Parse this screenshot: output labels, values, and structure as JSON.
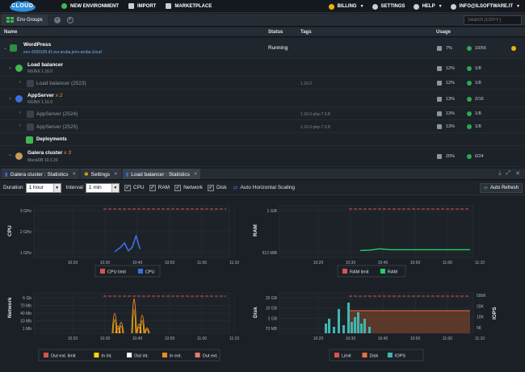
{
  "topbar": {
    "logo_text": "CLOUD",
    "new_environment": "NEW ENVIRONMENT",
    "import": "IMPORT",
    "marketplace": "MARKETPLACE",
    "billing": "BILLING",
    "settings": "SETTINGS",
    "help": "HELP",
    "user": "INFO@ILSOFTWARE.IT"
  },
  "groups": {
    "tab_label": "Env Groups",
    "search_placeholder": "Search (Ctrl+F)"
  },
  "columns": {
    "name": "Name",
    "status": "Status",
    "tags": "Tags",
    "usage": "Usage"
  },
  "environments": [
    {
      "name": "WordPress",
      "domain": "env-3289199.it1.eur.aruba.jenv-aruba.cloud",
      "status": "Running",
      "disk": "7%",
      "cloudlets": "10/56"
    },
    {
      "name": "Load balancer",
      "version": "NGINX 1.16.0",
      "disk": "12%",
      "cloudlets": "1/8"
    },
    {
      "name": "Load balancer (2523)",
      "tag": "1.16.0",
      "disk": "12%",
      "cloudlets": "1/8"
    },
    {
      "name": "AppServer",
      "mult": "x 2",
      "version": "NGINX 1.16.0",
      "disk": "13%",
      "cloudlets": "2/16"
    },
    {
      "name": "AppServer (2524)",
      "tag": "1.16.0-php-7.3.8",
      "disk": "13%",
      "cloudlets": "1/8"
    },
    {
      "name": "AppServer (2525)",
      "tag": "1.16.0-php-7.3.8",
      "disk": "13%",
      "cloudlets": "1/8"
    },
    {
      "name": "Deployments"
    },
    {
      "name": "Galera cluster",
      "mult": "x 3",
      "version": "MariaDB 10.3.20",
      "disk": "20%",
      "cloudlets": "6/24"
    }
  ],
  "panel": {
    "tabs": [
      "Galera cluster : Statistics",
      "Settings",
      "Load balancer : Statistics"
    ],
    "duration_label": "Duration",
    "duration_value": "1 hour",
    "interval_label": "Interval",
    "interval_value": "1 min",
    "checks": [
      "CPU",
      "RAM",
      "Network",
      "Disk"
    ],
    "auto_scaling": "Auto Horizontal Scaling",
    "auto_refresh": "Auto Refresh"
  },
  "colors": {
    "limit": "#d9534f",
    "cpu": "#3b6fe0",
    "ram": "#23d160",
    "net_in_int": "#ffffff",
    "net_in": "#ffd600",
    "net_in_ext": "#f38a1e",
    "net_out_ext": "#e87a72",
    "disk": "#e8713a",
    "iops": "#3fb6b0"
  },
  "chart_data": [
    {
      "type": "line",
      "ylabel": "CPU",
      "x_ticks": [
        "10:20",
        "10:30",
        "10:40",
        "10:50",
        "11:00",
        "11:10"
      ],
      "y_ticks": [
        "1 GHz",
        "2 GHz",
        "3 GHz"
      ],
      "series": [
        {
          "name": "CPU limit",
          "values": [
            3.4,
            3.4,
            3.4,
            3.4,
            3.4,
            3.4,
            3.4
          ]
        },
        {
          "name": "CPU",
          "points": [
            [
              10.55,
              0.05
            ],
            [
              10.58,
              0.3
            ],
            [
              10.6,
              0.55
            ],
            [
              10.62,
              0.1
            ],
            [
              10.64,
              0.3
            ],
            [
              10.66,
              0.95
            ],
            [
              10.68,
              0.2
            ]
          ]
        }
      ],
      "legend": [
        "CPU limit",
        "CPU"
      ]
    },
    {
      "type": "line",
      "ylabel": "RAM",
      "x_ticks": [
        "10:20",
        "10:30",
        "10:40",
        "10:50",
        "11:00",
        "11:10"
      ],
      "y_ticks": [
        "512 MiB",
        "1 GiB"
      ],
      "series": [
        {
          "name": "RAM limit",
          "values": [
            1.0,
            1.0,
            1.0,
            1.0,
            1.0,
            1.0,
            1.0
          ]
        },
        {
          "name": "RAM",
          "points": [
            [
              10.55,
              0.05
            ],
            [
              10.6,
              0.06
            ],
            [
              10.65,
              0.09
            ],
            [
              10.7,
              0.07
            ],
            [
              11.2,
              0.07
            ]
          ]
        }
      ],
      "legend": [
        "RAM limit",
        "RAM"
      ]
    },
    {
      "type": "line",
      "ylabel": "Network",
      "x_ticks": [
        "10:20",
        "10:30",
        "10:40",
        "10:50",
        "11:00",
        "11:10"
      ],
      "y_ticks": [
        "1 Mb",
        "10 Mb",
        "40 Mb",
        "70 Mb",
        "6 Gb"
      ],
      "series": [
        {
          "name": "Out ext. limit",
          "values": [
            6,
            6,
            6,
            6,
            6,
            6,
            6
          ]
        },
        {
          "name": "In int."
        },
        {
          "name": "Out int."
        },
        {
          "name": "In ext."
        },
        {
          "name": "Out ext."
        }
      ],
      "legend": [
        "Out ext. limit",
        "In int.",
        "Out int.",
        "In ext.",
        "Out ext."
      ]
    },
    {
      "type": "bar",
      "ylabel": "Disk",
      "y2label": "IOPS",
      "x_ticks": [
        "10:20",
        "10:30",
        "10:40",
        "10:50",
        "11:00",
        "11:10"
      ],
      "y_ticks": [
        "70 MB",
        "2 GB",
        "10 GB",
        "20 GB"
      ],
      "y2_ticks": [
        "500K",
        "20K",
        "10K",
        "5K"
      ],
      "series": [
        {
          "name": "Limit",
          "values": [
            20,
            20,
            20,
            20,
            20,
            20,
            20
          ]
        },
        {
          "name": "Disk"
        },
        {
          "name": "IOPS"
        }
      ],
      "legend": [
        "Limit",
        "Disk",
        "IOPS"
      ]
    }
  ]
}
